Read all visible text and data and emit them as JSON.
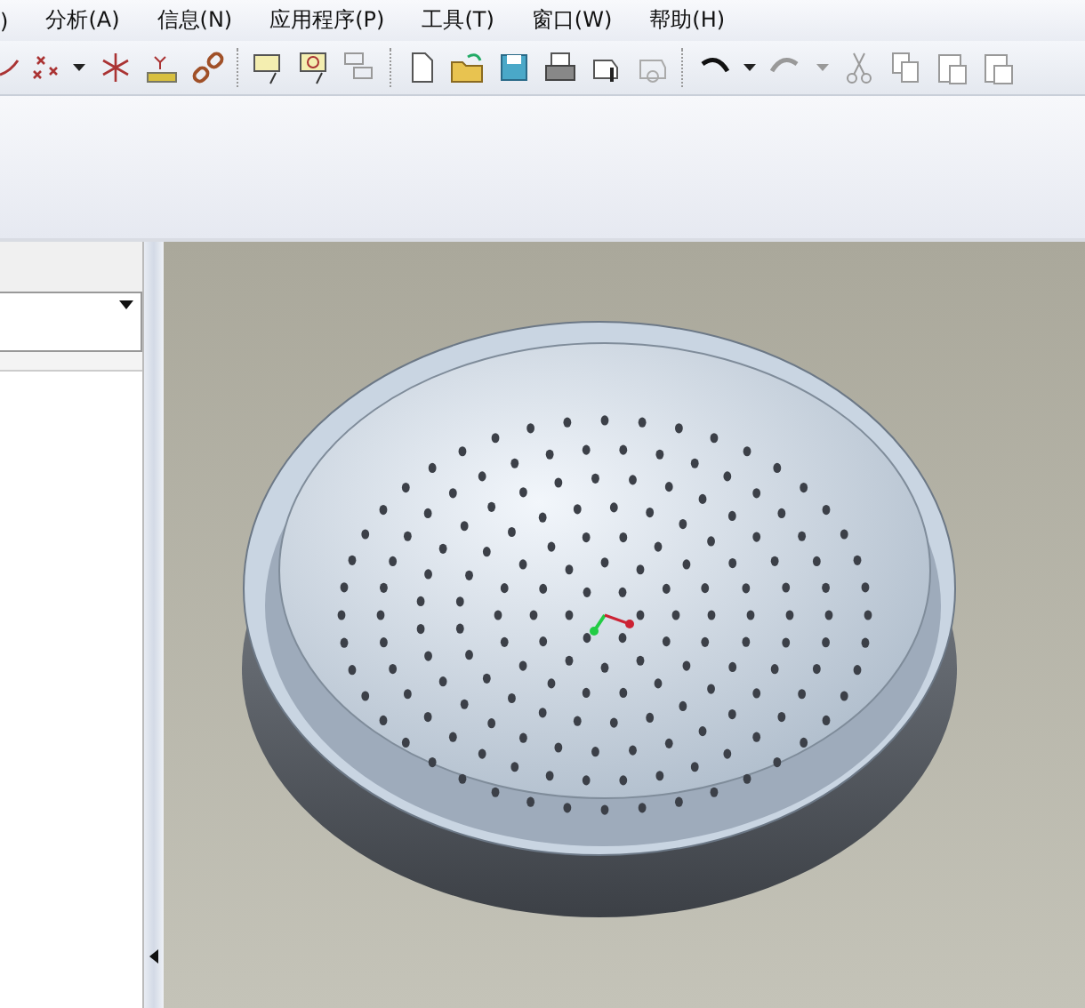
{
  "menu": [
    ")",
    "分析(A)",
    "信息(N)",
    "应用程序(P)",
    "工具(T)",
    "窗口(W)",
    "帮助(H)"
  ]
}
